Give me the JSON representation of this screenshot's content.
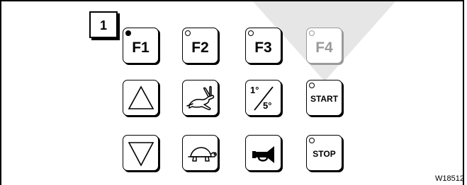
{
  "callout": {
    "number": "1"
  },
  "keys": {
    "f1": {
      "label": "F1",
      "led": "on"
    },
    "f2": {
      "label": "F2",
      "led": "off"
    },
    "f3": {
      "label": "F3",
      "led": "off"
    },
    "f4": {
      "label": "F4",
      "led": "off",
      "state": "disabled"
    },
    "up": {
      "icon": "triangle-up-icon"
    },
    "fast": {
      "icon": "hare-icon"
    },
    "degree": {
      "icon": "degree-step-icon",
      "top": "1°",
      "bottom": "5°"
    },
    "start": {
      "label": "START",
      "led": "off"
    },
    "down": {
      "icon": "triangle-down-icon"
    },
    "slow": {
      "icon": "tortoise-icon"
    },
    "horn": {
      "icon": "horn-icon"
    },
    "stop": {
      "label": "STOP",
      "led": "off"
    }
  },
  "figure_id": "W18512",
  "colors": {
    "ink": "#000000",
    "disabled": "#9a9a9a",
    "background_triangle": "#e6e6e6"
  }
}
